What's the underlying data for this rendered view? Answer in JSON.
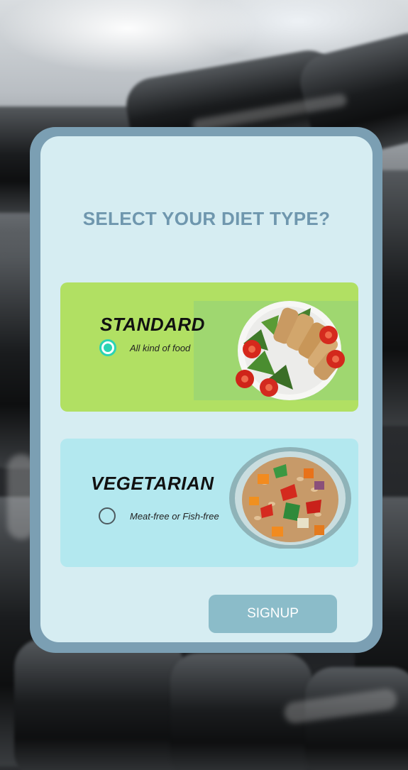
{
  "page": {
    "title": "SELECT YOUR DIET TYPE?"
  },
  "options": [
    {
      "title": "STANDARD",
      "description": "All kind of food",
      "selected": true,
      "image": "salad-with-grilled-chicken"
    },
    {
      "title": "VEGETARIAN",
      "description": "Meat-free or Fish-free",
      "selected": false,
      "image": "vegetable-grain-bowl"
    }
  ],
  "signup": {
    "label": "SIGNUP"
  },
  "colors": {
    "title": "#6f97ae",
    "standard_card": "#b1e063",
    "vegetarian_card": "#b3e8ef",
    "radio_accent": "#2ad3b4",
    "signup_button": "#8bbcc9",
    "card_background": "#d6edf2",
    "card_border": "#7b9fb3"
  }
}
